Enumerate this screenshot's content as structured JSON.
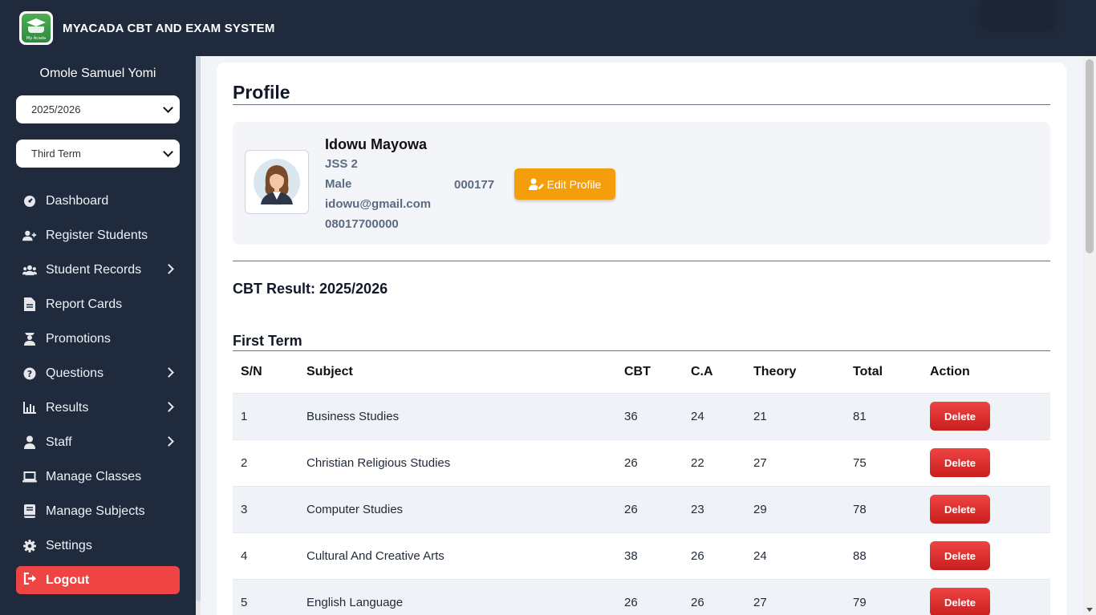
{
  "app": {
    "title": "MYACADA CBT AND EXAM SYSTEM",
    "logo_text": "My Acada"
  },
  "sidebar": {
    "user_name": "Omole Samuel Yomi",
    "session_select": "2025/2026",
    "term_select": "Third Term",
    "items": [
      {
        "label": "Dashboard",
        "icon": "dashboard-icon",
        "has_submenu": false
      },
      {
        "label": "Register Students",
        "icon": "user-plus-icon",
        "has_submenu": false
      },
      {
        "label": "Student Records",
        "icon": "users-icon",
        "has_submenu": true
      },
      {
        "label": "Report Cards",
        "icon": "document-icon",
        "has_submenu": false
      },
      {
        "label": "Promotions",
        "icon": "graduation-icon",
        "has_submenu": false
      },
      {
        "label": "Questions",
        "icon": "question-icon",
        "has_submenu": true
      },
      {
        "label": "Results",
        "icon": "chart-icon",
        "has_submenu": true
      },
      {
        "label": "Staff",
        "icon": "person-icon",
        "has_submenu": true
      },
      {
        "label": "Manage Classes",
        "icon": "laptop-icon",
        "has_submenu": false
      },
      {
        "label": "Manage Subjects",
        "icon": "book-icon",
        "has_submenu": false
      },
      {
        "label": "Settings",
        "icon": "gear-icon",
        "has_submenu": false
      }
    ],
    "logout_label": "Logout"
  },
  "profile": {
    "page_title": "Profile",
    "name": "Idowu Mayowa",
    "class": "JSS 2",
    "gender": "Male",
    "email": "idowu@gmail.com",
    "phone": "08017700000",
    "student_id": "000177",
    "edit_label": "Edit Profile"
  },
  "results": {
    "title": "CBT Result: 2025/2026",
    "term": "First Term",
    "columns": [
      "S/N",
      "Subject",
      "CBT",
      "C.A",
      "Theory",
      "Total",
      "Action"
    ],
    "delete_label": "Delete",
    "rows": [
      {
        "sn": "1",
        "subject": "Business Studies",
        "cbt": "36",
        "ca": "24",
        "theory": "21",
        "total": "81"
      },
      {
        "sn": "2",
        "subject": "Christian Religious Studies",
        "cbt": "26",
        "ca": "22",
        "theory": "27",
        "total": "75"
      },
      {
        "sn": "3",
        "subject": "Computer Studies",
        "cbt": "26",
        "ca": "23",
        "theory": "29",
        "total": "78"
      },
      {
        "sn": "4",
        "subject": "Cultural And Creative Arts",
        "cbt": "38",
        "ca": "26",
        "theory": "24",
        "total": "88"
      },
      {
        "sn": "5",
        "subject": "English Language",
        "cbt": "26",
        "ca": "26",
        "theory": "27",
        "total": "79"
      }
    ]
  },
  "colors": {
    "sidebar_bg": "#1f2a3d",
    "logout_bg": "#ef4444",
    "edit_btn_bg": "#f59e0b",
    "delete_btn_bg": "#dc2626"
  }
}
